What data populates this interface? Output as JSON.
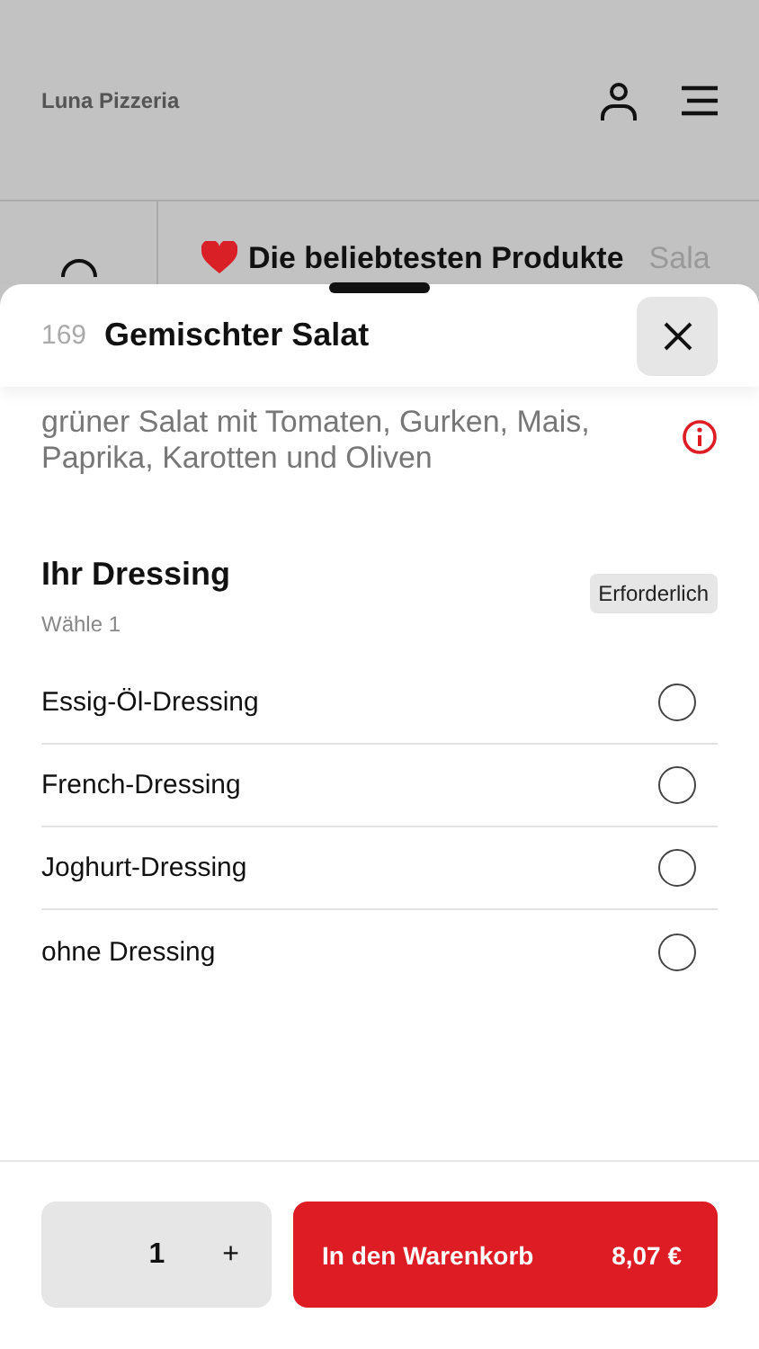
{
  "header": {
    "title": "Luna Pizzeria"
  },
  "categories": [
    {
      "label": "Die beliebtesten Produkte",
      "selected": true
    },
    {
      "label": "Sala",
      "selected": false
    }
  ],
  "product": {
    "number": "169",
    "name": "Gemischter Salat",
    "description": "grüner Salat mit Tomaten, Gurken, Mais, Paprika, Karotten und Oliven"
  },
  "option_group": {
    "title": "Ihr Dressing",
    "hint": "Wähle 1",
    "badge": "Erforderlich",
    "options": [
      {
        "label": "Essig-Öl-Dressing",
        "selected": false
      },
      {
        "label": "French-Dressing",
        "selected": false
      },
      {
        "label": "Joghurt-Dressing",
        "selected": false
      },
      {
        "label": "ohne Dressing",
        "selected": false
      }
    ]
  },
  "footer": {
    "quantity": "1",
    "plus": "+",
    "cart_button": "In den Warenkorb",
    "price": "8,07 €"
  }
}
